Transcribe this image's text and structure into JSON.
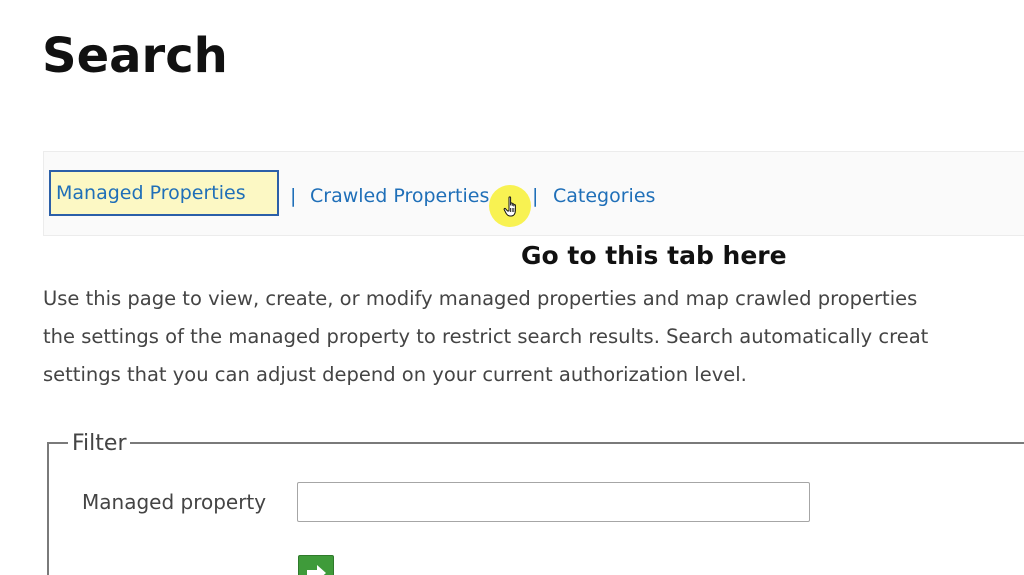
{
  "page": {
    "title": "Search"
  },
  "tabs": {
    "items": [
      {
        "label": "Managed Properties",
        "active": true
      },
      {
        "label": "Crawled Properties",
        "active": false
      },
      {
        "label": "Categories",
        "active": false
      }
    ],
    "separator": "|"
  },
  "annotation": {
    "text": "Go to this tab here"
  },
  "description": {
    "lines": [
      "Use this page to view, create, or modify managed properties and map crawled properties",
      "the settings of the managed property to restrict search results. Search automatically creat",
      "settings that you can adjust depend on your current authorization level."
    ]
  },
  "filter": {
    "legend": "Filter",
    "managed_property_label": "Managed property",
    "managed_property_value": "",
    "go_icon": "green-arrow-right-icon"
  },
  "colors": {
    "link": "#1f6fb8",
    "active_tab_bg": "#fcf8c4",
    "active_tab_border": "#2b5fa8",
    "cursor_highlight": "#f8f028",
    "go_button": "#3f9b3a"
  }
}
